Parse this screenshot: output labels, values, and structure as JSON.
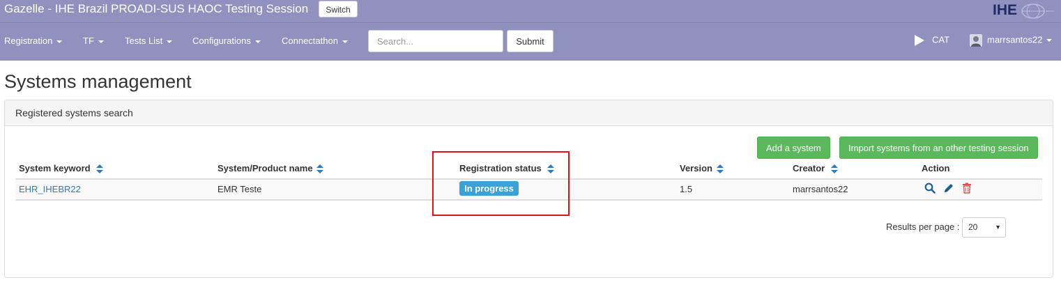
{
  "header": {
    "title": "Gazelle - IHE Brazil PROADI-SUS HAOC Testing Session",
    "switch_label": "Switch",
    "logo_text": "IHE"
  },
  "nav": {
    "items": [
      {
        "label": "Registration"
      },
      {
        "label": "TF"
      },
      {
        "label": "Tests List"
      },
      {
        "label": "Configurations"
      },
      {
        "label": "Connectathon"
      }
    ],
    "search_placeholder": "Search...",
    "submit_label": "Submit",
    "cat_label": "CAT",
    "user_name": "marrsantos22"
  },
  "page": {
    "title": "Systems management",
    "panel_title": "Registered systems search",
    "buttons": {
      "add_system": "Add a system",
      "import_systems": "Import systems from an other testing session"
    },
    "table": {
      "columns": [
        "System keyword",
        "System/Product name",
        "Registration status",
        "Version",
        "Creator",
        "Action"
      ],
      "rows": [
        {
          "keyword": "EHR_IHEBR22",
          "name": "EMR Teste",
          "status": "In progress",
          "version": "1.5",
          "creator": "marrsantos22"
        }
      ]
    },
    "results_per_page_label": "Results per page :",
    "results_per_page_value": "20"
  },
  "colors": {
    "navbar": "#9191bf",
    "success": "#5cb85c",
    "badge": "#3ba1d6",
    "link": "#337ab7",
    "highlight": "#e0101a",
    "delete": "#d9534f"
  }
}
